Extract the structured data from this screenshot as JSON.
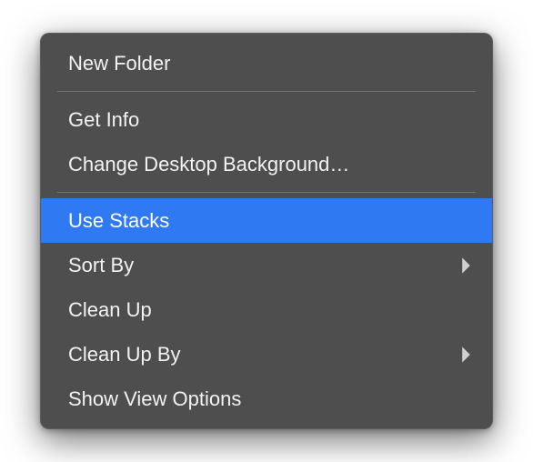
{
  "menu": {
    "items": [
      {
        "label": "New Folder",
        "submenu": false,
        "highlighted": false
      },
      {
        "separator": true
      },
      {
        "label": "Get Info",
        "submenu": false,
        "highlighted": false
      },
      {
        "label": "Change Desktop Background…",
        "submenu": false,
        "highlighted": false
      },
      {
        "separator": true
      },
      {
        "label": "Use Stacks",
        "submenu": false,
        "highlighted": true
      },
      {
        "label": "Sort By",
        "submenu": true,
        "highlighted": false
      },
      {
        "label": "Clean Up",
        "submenu": false,
        "highlighted": false
      },
      {
        "label": "Clean Up By",
        "submenu": true,
        "highlighted": false
      },
      {
        "label": "Show View Options",
        "submenu": false,
        "highlighted": false
      }
    ]
  },
  "colors": {
    "menu_bg": "#4e4e4e",
    "highlight": "#2f7af3",
    "text": "#f2f2f2"
  }
}
